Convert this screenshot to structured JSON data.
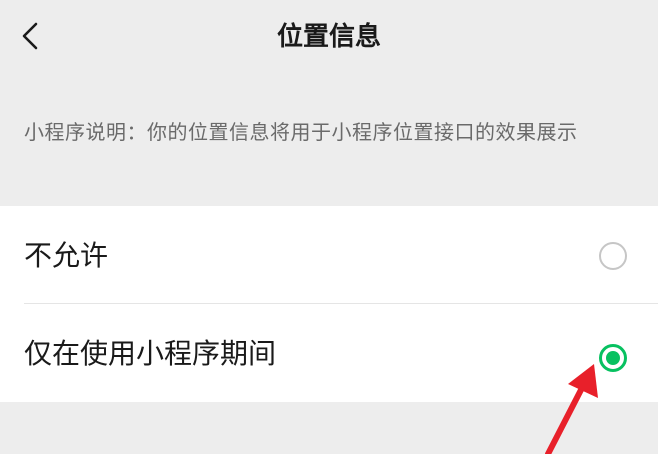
{
  "header": {
    "back_icon": "chevron-left-icon",
    "title": "位置信息"
  },
  "description": {
    "text": "小程序说明：你的位置信息将用于小程序位置接口的效果展示"
  },
  "options": [
    {
      "label": "不允许",
      "selected": false
    },
    {
      "label": "仅在使用小程序期间",
      "selected": true
    }
  ],
  "colors": {
    "accent": "#07c160",
    "annotation_arrow": "#e8202a",
    "background": "#ededed",
    "card": "#ffffff"
  }
}
